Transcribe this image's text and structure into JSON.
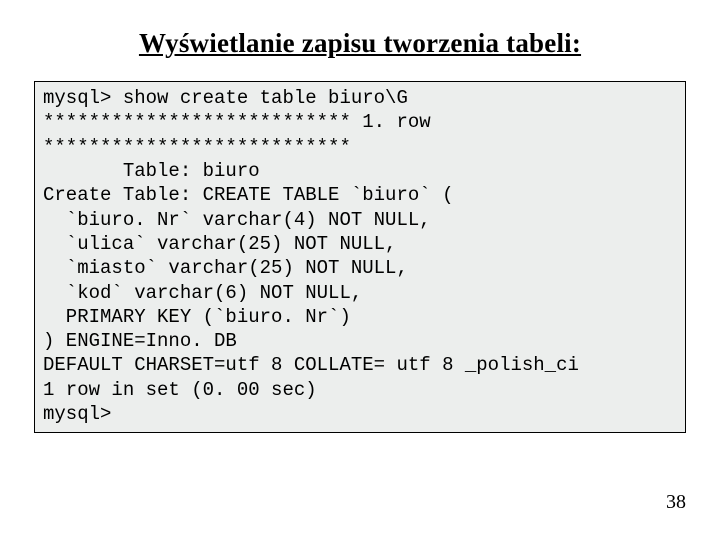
{
  "title": "Wyświetlanie zapisu tworzenia tabeli:",
  "code": {
    "l01": "mysql> show create table biuro\\G",
    "l02": "*************************** 1. row",
    "l03": "***************************",
    "l04": "       Table: biuro",
    "l05": "Create Table: CREATE TABLE `biuro` (",
    "l06": "  `biuro. Nr` varchar(4) NOT NULL,",
    "l07": "  `ulica` varchar(25) NOT NULL,",
    "l08": "  `miasto` varchar(25) NOT NULL,",
    "l09": "  `kod` varchar(6) NOT NULL,",
    "l10": "  PRIMARY KEY (`biuro. Nr`)",
    "l11": ") ENGINE=Inno. DB",
    "l12": "DEFAULT CHARSET=utf 8 COLLATE= utf 8 _polish_ci",
    "l13": "1 row in set (0. 00 sec)",
    "l14": "mysql>"
  },
  "page_number": "38"
}
